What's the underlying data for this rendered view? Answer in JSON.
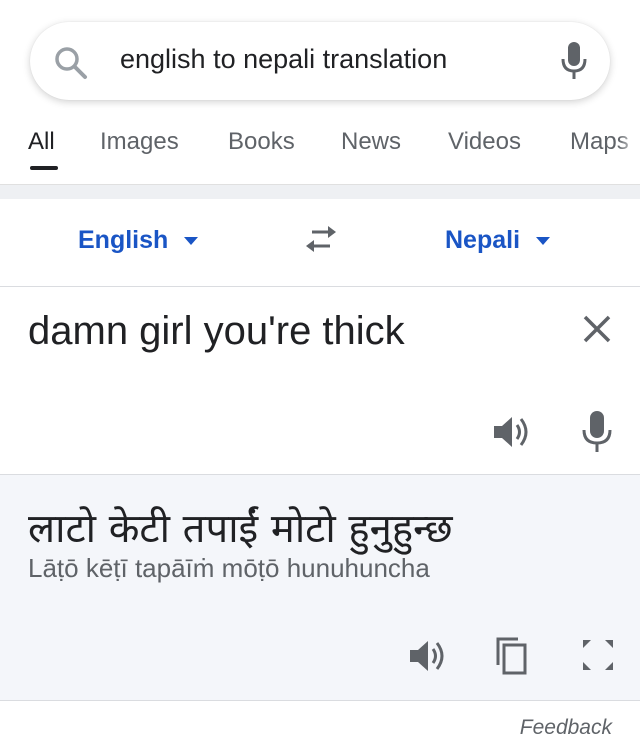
{
  "search": {
    "query": "english to nepali translation"
  },
  "tabs": [
    {
      "label": "All"
    },
    {
      "label": "Images"
    },
    {
      "label": "Books"
    },
    {
      "label": "News"
    },
    {
      "label": "Videos"
    },
    {
      "label": "Maps"
    }
  ],
  "translator": {
    "source_language": "English",
    "target_language": "Nepali",
    "source_text": "damn girl you're thick",
    "result_text": "लाटो केटी तपाईं मोटो हुनुहुन्छ",
    "transliteration": "Lāṭō kēṭī tapāīṁ mōṭō hunuhuncha"
  },
  "footer": {
    "feedback_label": "Feedback"
  },
  "colors": {
    "accent": "#1a55c5",
    "icon_gray": "#5f6368",
    "result_bg": "#f4f6fa"
  }
}
